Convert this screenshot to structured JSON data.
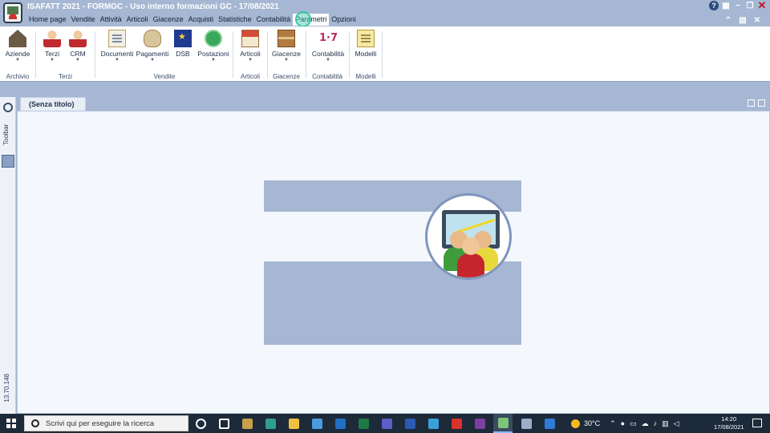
{
  "window": {
    "title": "ISAFATT 2021 - FORMGC - Uso interno formazioni GC - 17/08/2021",
    "controls": [
      "help-icon",
      "grid-icon",
      "minimize-icon",
      "restore-icon",
      "close-icon"
    ]
  },
  "menubar": {
    "items": [
      "Home page",
      "Vendite",
      "Attività",
      "Articoli",
      "Giacenze",
      "Acquisti",
      "Statistiche",
      "Contabilità",
      "Parametri",
      "Opzioni"
    ],
    "active": "Parametri"
  },
  "ribbon": {
    "groups": [
      {
        "name": "Archivio",
        "buttons": [
          {
            "label": "Aziende",
            "icon": "house-icon",
            "dropdown": true
          }
        ]
      },
      {
        "name": "Terzi",
        "buttons": [
          {
            "label": "Terzi",
            "icon": "person-icon",
            "dropdown": true
          },
          {
            "label": "CRM",
            "icon": "person-icon",
            "dropdown": true
          }
        ]
      },
      {
        "name": "Vendite",
        "buttons": [
          {
            "label": "Documenti",
            "icon": "document-icon",
            "dropdown": true
          },
          {
            "label": "Pagamenti",
            "icon": "money-bag-icon",
            "dropdown": true
          },
          {
            "label": "DSB",
            "icon": "eu-flag-icon",
            "dropdown": false
          },
          {
            "label": "Postazioni",
            "icon": "globe-icon",
            "dropdown": true
          }
        ]
      },
      {
        "name": "Articoli",
        "buttons": [
          {
            "label": "Articoli",
            "icon": "shop-icon",
            "dropdown": true
          }
        ]
      },
      {
        "name": "Giacenze",
        "buttons": [
          {
            "label": "Giacenze",
            "icon": "box-icon",
            "dropdown": true
          }
        ]
      },
      {
        "name": "Contabilità",
        "buttons": [
          {
            "label": "Contabilità",
            "icon": "numbering-icon",
            "dropdown": true
          }
        ]
      },
      {
        "name": "Modelli",
        "buttons": [
          {
            "label": "Modelli",
            "icon": "note-icon",
            "dropdown": false
          }
        ]
      }
    ]
  },
  "document": {
    "tab_label": "(Senza titolo)"
  },
  "siderail": {
    "toolbar_label": "Toolbar",
    "version": "13.70.148"
  },
  "taskbar": {
    "search_placeholder": "Scrivi qui per eseguire la ricerca",
    "weather": "30°C",
    "time": "14:20",
    "date": "17/08/2021",
    "apps": [
      {
        "name": "task-view-icon",
        "color": "#1d2a3a"
      },
      {
        "name": "widgets-icon",
        "color": "#1d2a3a"
      },
      {
        "name": "key-icon",
        "color": "#c8a04a"
      },
      {
        "name": "edge-icon",
        "color": "#2f9e8f"
      },
      {
        "name": "file-explorer-icon",
        "color": "#f0c040"
      },
      {
        "name": "store-icon",
        "color": "#4a9be0"
      },
      {
        "name": "outlook-icon",
        "color": "#1f6fc5"
      },
      {
        "name": "excel-icon",
        "color": "#1e7a45"
      },
      {
        "name": "teams-icon",
        "color": "#5b5fc7"
      },
      {
        "name": "word-icon",
        "color": "#2b5ab5"
      },
      {
        "name": "webex-icon",
        "color": "#3aa0d8"
      },
      {
        "name": "acrobat-icon",
        "color": "#d9342b"
      },
      {
        "name": "onenote-icon",
        "color": "#7b3fa0"
      },
      {
        "name": "isafatt-icon",
        "color": "#7cc47a"
      },
      {
        "name": "download-icon",
        "color": "#9bb0c8"
      },
      {
        "name": "help-icon",
        "color": "#2f7bd8"
      }
    ]
  }
}
